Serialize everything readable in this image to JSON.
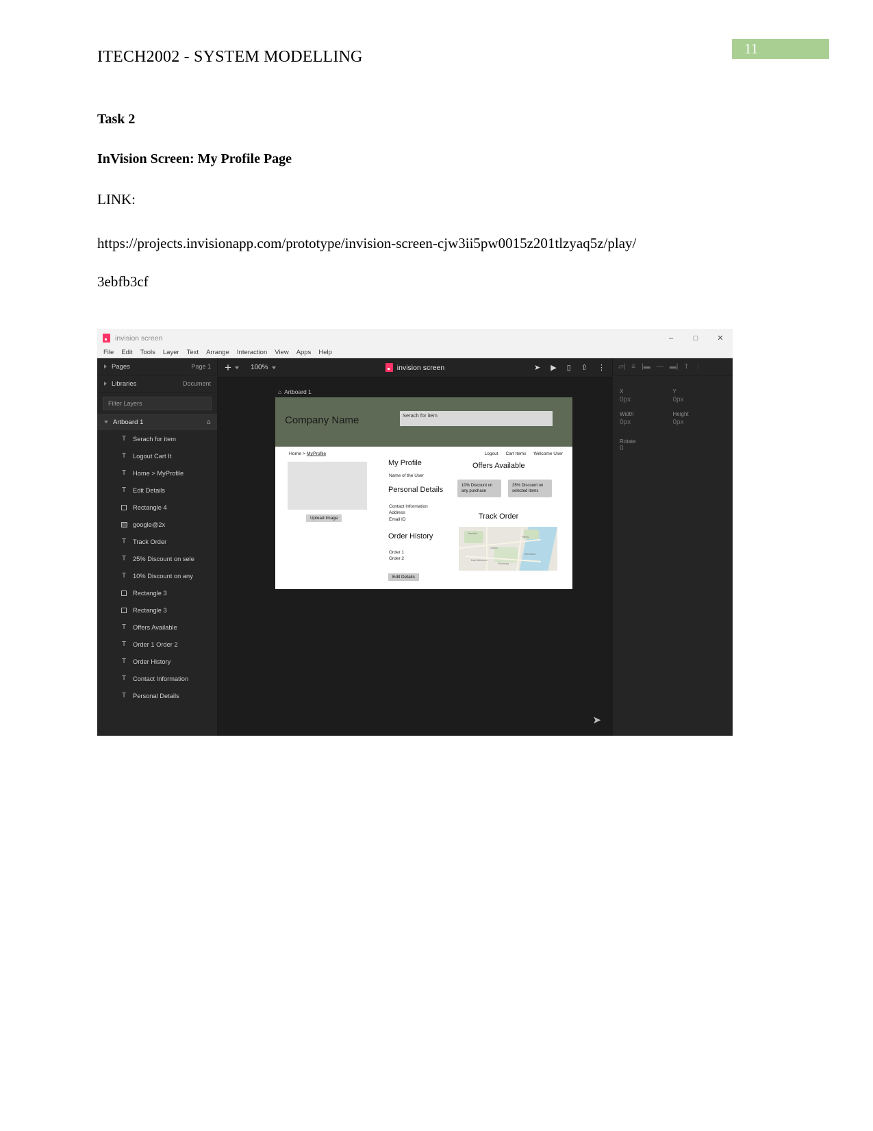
{
  "document": {
    "header_title": "ITECH2002 - SYSTEM MODELLING",
    "page_number": "11",
    "task_heading": "Task 2",
    "screen_heading": "InVision Screen: My Profile Page",
    "link_label": "LINK:",
    "url_line1": "https://projects.invisionapp.com/prototype/invision-screen-cjw3ii5pw0015z201tlzyaq5z/play/",
    "url_line2": "3ebfb3cf",
    "accent_green": "#a9cf93"
  },
  "app": {
    "titlebar": {
      "title": "invision screen",
      "minimize": "–",
      "maximize": "□",
      "close": "✕"
    },
    "menubar": [
      "File",
      "Edit",
      "Tools",
      "Layer",
      "Text",
      "Arrange",
      "Interaction",
      "View",
      "Apps",
      "Help"
    ],
    "toolbar": {
      "add_label": "+",
      "zoom_level": "100%",
      "document_title": "invision screen",
      "icons": [
        "cursor-flow-icon",
        "play-icon",
        "device-preview-icon",
        "upload-icon",
        "overflow-menu-icon"
      ]
    },
    "sidebar": {
      "pages_label": "Pages",
      "pages_value": "Page 1",
      "libraries_label": "Libraries",
      "libraries_value": "Document",
      "filter_placeholder": "Filter Layers",
      "artboard_label": "Artboard 1",
      "layers": [
        {
          "name": "Serach for item",
          "icon": "text-layer-icon"
        },
        {
          "name": "Logout Cart It",
          "icon": "text-layer-icon"
        },
        {
          "name": "Home > MyProfile",
          "icon": "text-layer-icon"
        },
        {
          "name": "Edit Details",
          "icon": "text-layer-icon"
        },
        {
          "name": "Rectangle 4",
          "icon": "rectangle-layer-icon"
        },
        {
          "name": "google@2x",
          "icon": "image-layer-icon"
        },
        {
          "name": "Track Order",
          "icon": "text-layer-icon"
        },
        {
          "name": "25% Discount on sele",
          "icon": "text-layer-icon"
        },
        {
          "name": "10% Discount on any",
          "icon": "text-layer-icon"
        },
        {
          "name": "Rectangle 3",
          "icon": "rectangle-layer-icon"
        },
        {
          "name": "Rectangle 3",
          "icon": "rectangle-layer-icon"
        },
        {
          "name": "Offers Available",
          "icon": "text-layer-icon"
        },
        {
          "name": "Order 1 Order 2",
          "icon": "text-layer-icon"
        },
        {
          "name": "Order History",
          "icon": "text-layer-icon"
        },
        {
          "name": "Contact Information",
          "icon": "text-layer-icon"
        },
        {
          "name": "Personal Details",
          "icon": "text-layer-icon"
        }
      ]
    },
    "canvas": {
      "artboard_name": "Artboard 1"
    },
    "inspector": {
      "x_label": "X",
      "x_value": "0px",
      "y_label": "Y",
      "y_value": "0px",
      "width_label": "Width",
      "width_value": "0px",
      "height_label": "Height",
      "height_value": "0px",
      "rotate_label": "Rotate",
      "rotate_value": "0"
    }
  },
  "design": {
    "company_name": "Company Name",
    "search_placeholder": "Serach for item",
    "breadcrumb_home": "Home > ",
    "breadcrumb_current": "MyProfile",
    "topnav": [
      "Logout",
      "Cart Items",
      "Welcome User"
    ],
    "upload_button": "Upload Image",
    "my_profile_title": "My Profile",
    "user_name": "Name of the User",
    "personal_details_title": "Personal Details",
    "personal_details_lines": "Contact Information\nAddress\nEmail ID",
    "order_history_title": "Order History",
    "order_history_lines": "Order 1\nOrder 2",
    "edit_details_button": "Edit Details",
    "offers_title": "Offers Available",
    "offer1": "10% Discount on any purchase",
    "offer2": "25% Discount on selected items",
    "track_order_title": "Track Order",
    "map_labels": [
      "Parkville",
      "Carlton",
      "Fitzroy",
      "Abbotsford",
      "Richmond",
      "East Melbourne"
    ],
    "header_bg": "#5e6a55"
  }
}
